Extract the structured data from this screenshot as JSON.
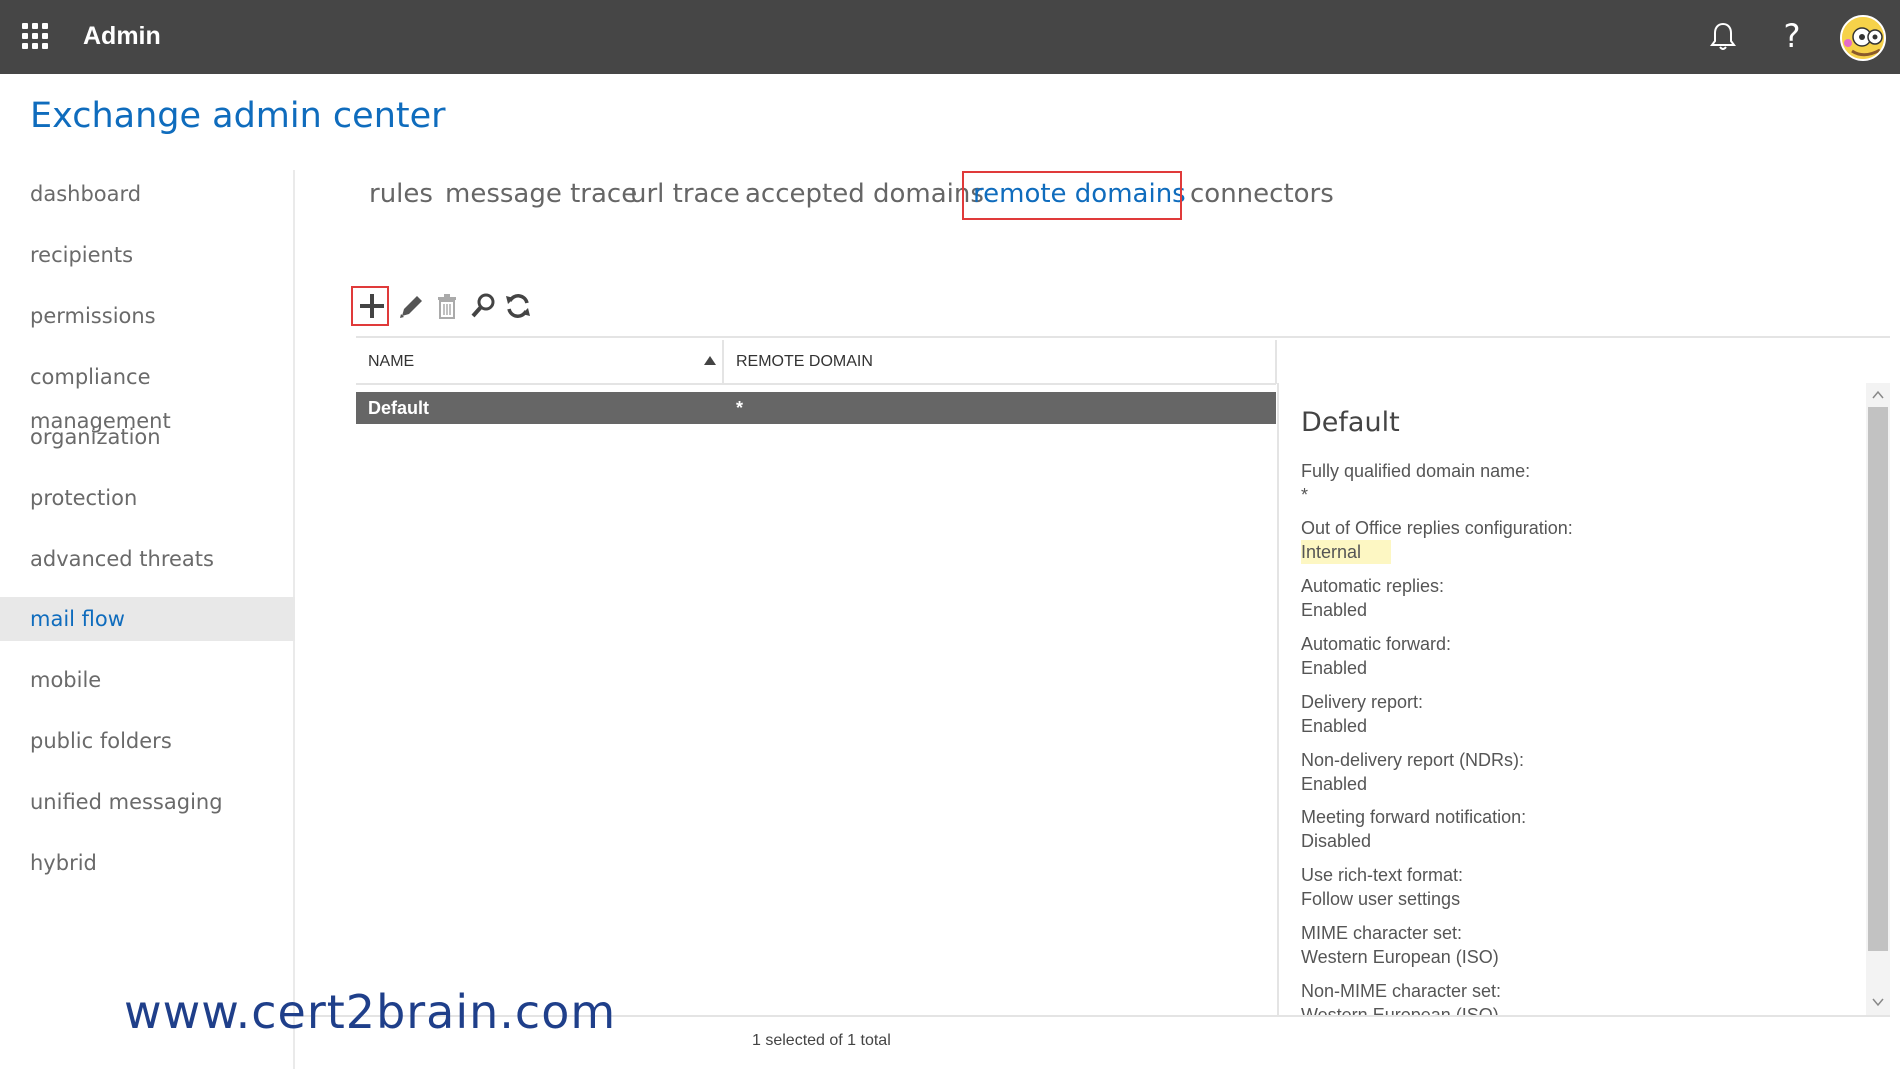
{
  "topbar": {
    "app_title": "Admin",
    "icons": [
      "app-launcher-icon",
      "bell-icon",
      "help-icon",
      "avatar"
    ]
  },
  "page": {
    "title": "Exchange admin center"
  },
  "sidebar": {
    "items": [
      {
        "label": "dashboard"
      },
      {
        "label": "recipients"
      },
      {
        "label": "permissions"
      },
      {
        "label": "compliance management"
      },
      {
        "label": "organization"
      },
      {
        "label": "protection"
      },
      {
        "label": "advanced threats"
      },
      {
        "label": "mail flow",
        "active": true
      },
      {
        "label": "mobile"
      },
      {
        "label": "public folders"
      },
      {
        "label": "unified messaging"
      },
      {
        "label": "hybrid"
      }
    ]
  },
  "tabs": [
    {
      "label": "rules"
    },
    {
      "label": "message trace"
    },
    {
      "label": "url trace"
    },
    {
      "label": "accepted domains"
    },
    {
      "label": "remote domains",
      "active": true
    },
    {
      "label": "connectors"
    }
  ],
  "toolbar": {
    "icons": [
      "add-icon",
      "edit-icon",
      "delete-icon",
      "search-icon",
      "refresh-icon"
    ]
  },
  "table": {
    "columns": [
      "NAME",
      "REMOTE DOMAIN"
    ],
    "sort": "NAME ascending",
    "rows": [
      {
        "name": "Default",
        "remote_domain": "*",
        "selected": true
      }
    ]
  },
  "detail": {
    "title": "Default",
    "properties": [
      {
        "label": "Fully qualified domain name:",
        "value": "*"
      },
      {
        "label": "Out of Office replies configuration:",
        "value": "Internal",
        "highlight": true
      },
      {
        "label": "Automatic replies:",
        "value": "Enabled"
      },
      {
        "label": "Automatic forward:",
        "value": "Enabled"
      },
      {
        "label": "Delivery report:",
        "value": "Enabled"
      },
      {
        "label": "Non-delivery report (NDRs):",
        "value": "Enabled"
      },
      {
        "label": "Meeting forward notification:",
        "value": "Disabled"
      },
      {
        "label": "Use rich-text format:",
        "value": "Follow user settings"
      },
      {
        "label": "MIME character set:",
        "value": "Western European (ISO)"
      },
      {
        "label": "Non-MIME character set:",
        "value": "Western European (ISO)"
      }
    ]
  },
  "status_text": "1 selected of 1 total",
  "watermark": "www.cert2brain.com",
  "colors": {
    "topbar": "#464646",
    "accent": "#0f6cbd",
    "highlight_box": "#e03a3a",
    "selected_row": "#666666",
    "value_highlight": "#fdf7c3"
  }
}
